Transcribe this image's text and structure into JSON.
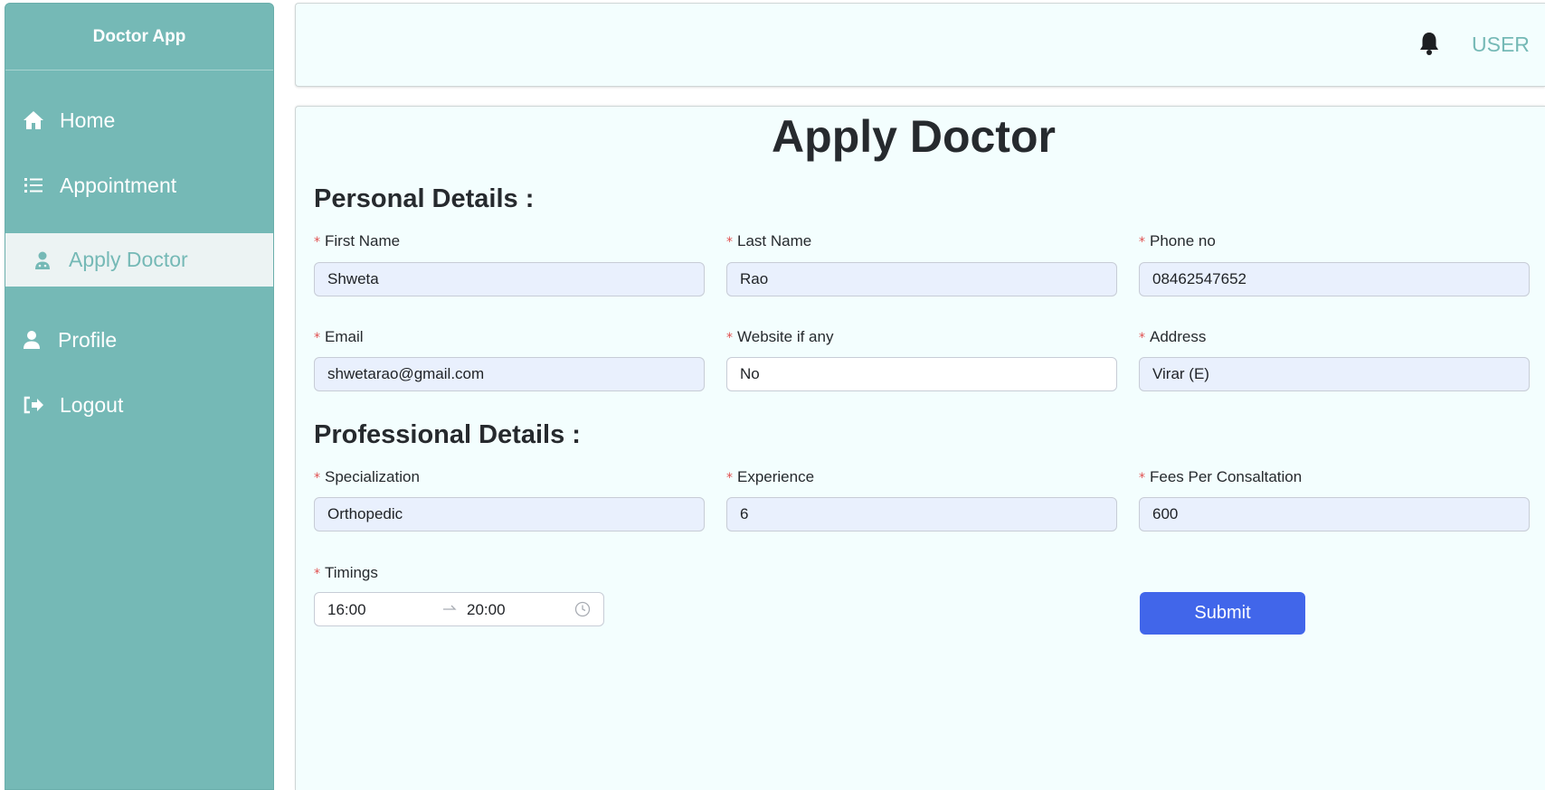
{
  "sidebar": {
    "brand": "Doctor App",
    "items": [
      {
        "label": "Home",
        "icon": "home-icon"
      },
      {
        "label": "Appointment",
        "icon": "list-icon"
      },
      {
        "label": "Apply Doctor",
        "icon": "doctor-icon",
        "active": true
      },
      {
        "label": "Profile",
        "icon": "user-icon"
      },
      {
        "label": "Logout",
        "icon": "logout-icon"
      }
    ]
  },
  "header": {
    "user_label": "USER",
    "bell_icon": "bell-icon"
  },
  "form": {
    "title": "Apply Doctor",
    "personal_heading": "Personal Details :",
    "professional_heading": "Professional Details :",
    "required_mark": "*",
    "fields": {
      "first_name": {
        "label": "First Name",
        "value": "Shweta"
      },
      "last_name": {
        "label": "Last Name",
        "value": "Rao"
      },
      "phone": {
        "label": "Phone no",
        "value": "08462547652"
      },
      "email": {
        "label": "Email",
        "value": "shwetarao@gmail.com"
      },
      "website": {
        "label": "Website if any",
        "value": "No"
      },
      "address": {
        "label": "Address",
        "value": "Virar (E)"
      },
      "specialization": {
        "label": "Specialization",
        "value": "Orthopedic"
      },
      "experience": {
        "label": "Experience",
        "value": "6"
      },
      "fees": {
        "label": "Fees Per Consaltation",
        "value": "600"
      },
      "timings": {
        "label": "Timings",
        "start": "16:00",
        "end": "20:00"
      }
    },
    "submit_label": "Submit"
  },
  "colors": {
    "sidebar": "#75b9b6",
    "panel": "#f3fefe",
    "input_fill": "#e9f0fd",
    "submit": "#4166ea",
    "required": "#e04f4f"
  }
}
